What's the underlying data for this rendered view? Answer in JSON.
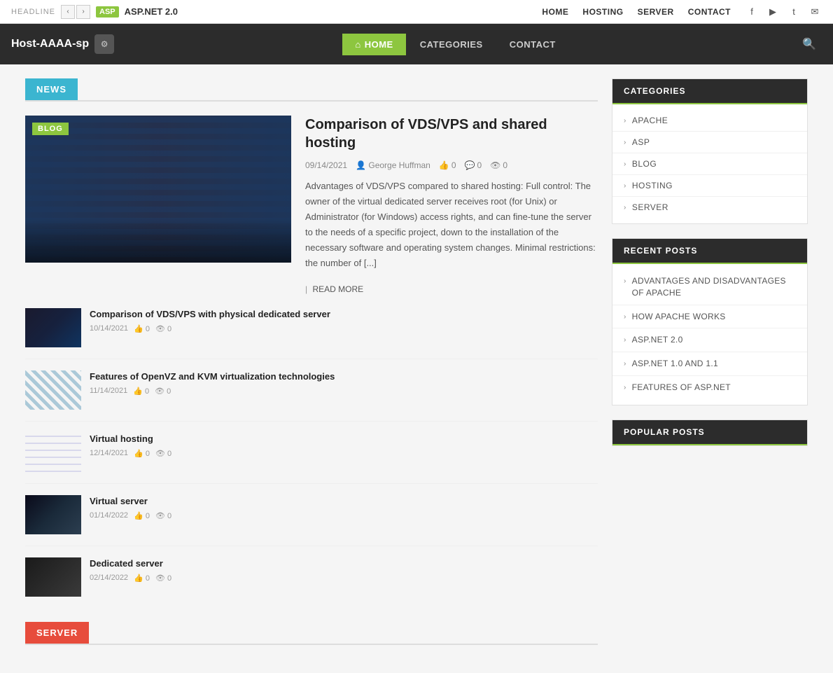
{
  "topbar": {
    "headline": "HEADLINE",
    "asp_badge": "ASP",
    "headline_title": "ASP.NET 2.0",
    "nav_links": [
      {
        "label": "HOME"
      },
      {
        "label": "HOSTING"
      },
      {
        "label": "SERVER"
      },
      {
        "label": "CONTACT"
      }
    ],
    "social": [
      "f",
      "▶",
      "t",
      "✉"
    ]
  },
  "mainnav": {
    "logo": "Host-AAAA-sp",
    "logo_icon": "⚙",
    "links": [
      {
        "label": "HOME",
        "active": true,
        "icon": "⌂"
      },
      {
        "label": "CATEGORIES",
        "active": false
      },
      {
        "label": "CONTACT",
        "active": false
      }
    ]
  },
  "news_section": {
    "tag": "NEWS",
    "featured": {
      "badge": "BLOG",
      "title": "Comparison of VDS/VPS and shared hosting",
      "date": "09/14/2021",
      "author": "George Huffman",
      "likes": "0",
      "comments": "0",
      "views": "0",
      "excerpt": "Advantages of VDS/VPS compared to shared hosting: Full control: The owner of the virtual dedicated server receives root (for Unix) or Administrator (for Windows) access rights, and can fine-tune the server to the needs of a specific project, down to the installation of the necessary software and operating system changes. Minimal restrictions: the number of [...]",
      "read_more": "READ MORE"
    },
    "side_posts": [
      {
        "title": "Comparison of VDS/VPS with physical dedicated server",
        "date": "10/14/2021",
        "likes": "0",
        "views": "0",
        "thumb_class": "thumb-1"
      },
      {
        "title": "Features of OpenVZ and KVM virtualization technologies",
        "date": "11/14/2021",
        "likes": "0",
        "views": "0",
        "thumb_class": "thumb-2"
      },
      {
        "title": "Virtual hosting",
        "date": "12/14/2021",
        "likes": "0",
        "views": "0",
        "thumb_class": "thumb-3"
      },
      {
        "title": "Virtual server",
        "date": "01/14/2022",
        "likes": "0",
        "views": "0",
        "thumb_class": "thumb-4"
      },
      {
        "title": "Dedicated server",
        "date": "02/14/2022",
        "likes": "0",
        "views": "0",
        "thumb_class": "thumb-5"
      }
    ]
  },
  "server_section": {
    "tag": "SERVER"
  },
  "sidebar": {
    "categories_header": "CATEGORIES",
    "categories": [
      {
        "label": "APACHE"
      },
      {
        "label": "ASP"
      },
      {
        "label": "BLOG"
      },
      {
        "label": "HOSTING"
      },
      {
        "label": "SERVER"
      }
    ],
    "recent_posts_header": "RECENT POSTS",
    "recent_posts": [
      {
        "label": "ADVANTAGES AND DISADVANTAGES OF APACHE"
      },
      {
        "label": "HOW APACHE WORKS"
      },
      {
        "label": "ASP.NET 2.0"
      },
      {
        "label": "ASP.NET 1.0 AND 1.1"
      },
      {
        "label": "FEATURES OF ASP.NET"
      }
    ],
    "popular_posts_header": "POPULAR POSTS"
  }
}
